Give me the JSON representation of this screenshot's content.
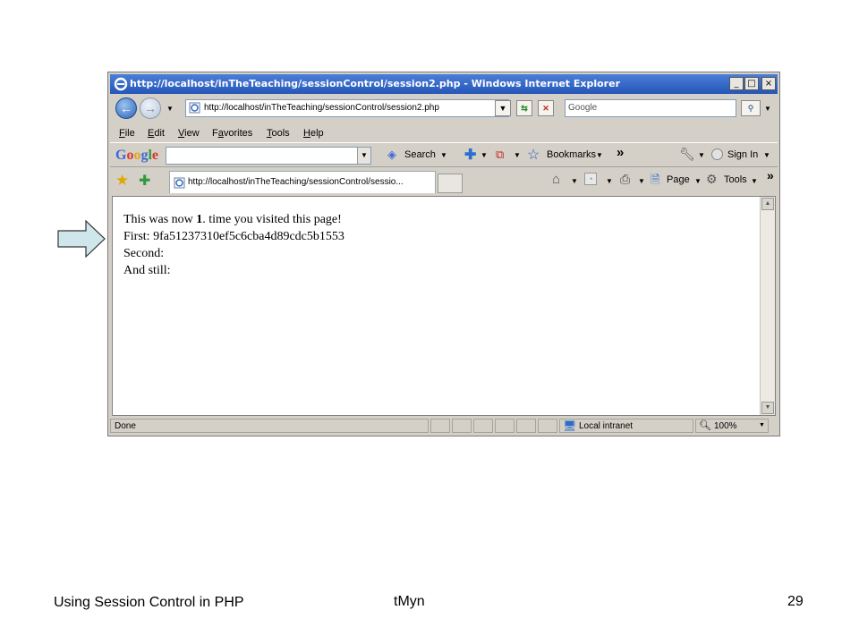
{
  "window": {
    "title": "http://localhost/inTheTeaching/sessionControl/session2.php - Windows Internet Explorer",
    "minimize": "_",
    "maximize": "□",
    "close": "×"
  },
  "nav": {
    "address": "http://localhost/inTheTeaching/sessionControl/session2.php",
    "search_placeholder": "Google"
  },
  "menu": {
    "items": [
      "File",
      "Edit",
      "View",
      "Favorites",
      "Tools",
      "Help"
    ]
  },
  "google_bar": {
    "logo": "Google",
    "search_label": "Search",
    "bookmarks_label": "Bookmarks",
    "more": "»",
    "sign_in_label": "Sign In"
  },
  "tab_bar": {
    "tab_title": "http://localhost/inTheTeaching/sessionControl/sessio...",
    "page_label": "Page",
    "tools_label": "Tools",
    "more": "»"
  },
  "page": {
    "line1_prefix": "This was now ",
    "line1_count": "1",
    "line1_suffix": ". time you visited this page!",
    "line2": "First: 9fa51237310ef5c6cba4d89cdc5b1553",
    "line3": "Second:",
    "line4": "And still:"
  },
  "status": {
    "text": "Done",
    "zone": "Local intranet",
    "zoom": "100%"
  },
  "slide": {
    "footer_left": "Using Session Control in PHP",
    "footer_center": "tMyn",
    "page_number": "29"
  },
  "colors": {
    "arrow_fill": "#cfe7ea",
    "titlebar": "#2556b8"
  }
}
